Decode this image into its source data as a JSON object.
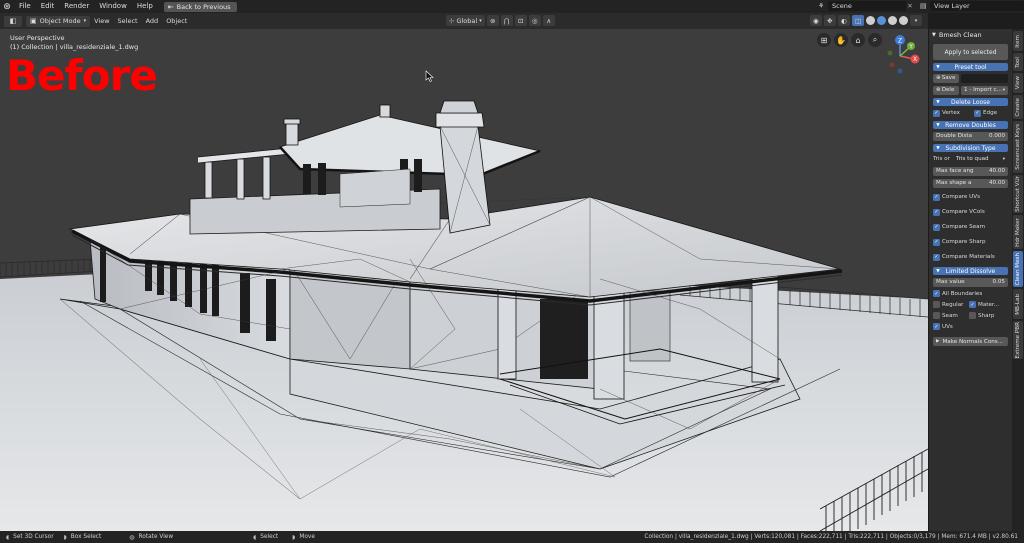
{
  "topbar": {
    "menus": [
      "File",
      "Edit",
      "Render",
      "Window",
      "Help"
    ],
    "back_button": "Back to Previous",
    "scene": "Scene",
    "view_layer": "View Layer"
  },
  "viewport_header": {
    "mode": "Object Mode",
    "menus": [
      "View",
      "Select",
      "Add",
      "Object"
    ],
    "orientation": "Global"
  },
  "viewport": {
    "view_name": "User Perspective",
    "collection_info": "(1) Collection | villa_residenziale_1.dwg",
    "overlay_label": "Before"
  },
  "gizmo": {
    "x": "X",
    "y": "Y",
    "z": "Z"
  },
  "npanel": {
    "title": "Bmesh Clean",
    "apply_button": "Apply to selected",
    "preset_tool": {
      "header": "Preset tool",
      "save": "Save",
      "delete": "Dele",
      "preset_value": "1 - Import c..."
    },
    "delete_loose": {
      "header": "Delete Loose",
      "vertex": "Vertex",
      "edge": "Edge"
    },
    "remove_doubles": {
      "header": "Remove Doubles",
      "distance_label": "Double Dista",
      "distance_value": "0.000"
    },
    "subdivision_type": {
      "header": "Subdivision Type",
      "left_label": "Tris or",
      "select_value": "Tris to quad",
      "max_face_label": "Max face ang",
      "max_face_value": "40.00",
      "max_shape_label": "Max shape a",
      "max_shape_value": "40.00",
      "compare_uvs": "Compare UVs",
      "compare_vcols": "Compare VCols",
      "compare_seam": "Compare Seam",
      "compare_sharp": "Compare Sharp",
      "compare_materials": "Compare Materials"
    },
    "limited_dissolve": {
      "header": "Limited Dissolve",
      "max_value_label": "Max value",
      "max_value": "0.05",
      "all_boundaries": "All Boundaries",
      "regular": "Regular",
      "materials": "Mater...",
      "seam": "Seam",
      "sharp": "Sharp",
      "uvs": "UVs"
    },
    "make_normals": "Make Normals Cons..."
  },
  "vtabs": [
    "Item",
    "Tool",
    "View",
    "Create",
    "Screencast Keys",
    "Shortcut VUr",
    "Hdr Maker",
    "Clean Mesh",
    "MB-Lab",
    "Extreme PBR"
  ],
  "statusbar": {
    "set_cursor": "Set 3D Cursor",
    "box_select": "Box Select",
    "rotate_view": "Rotate View",
    "select": "Select",
    "move": "Move",
    "stats": "Collection | villa_residenziale_1.dwg | Verts:120,081 | Faces:222,711 | Tris:222,711 | Objects:0/3,179 | Mem: 671.4 MB | v2.80.61"
  },
  "colors": {
    "accent": "#4772b3",
    "overlay_red": "#ff0000"
  }
}
